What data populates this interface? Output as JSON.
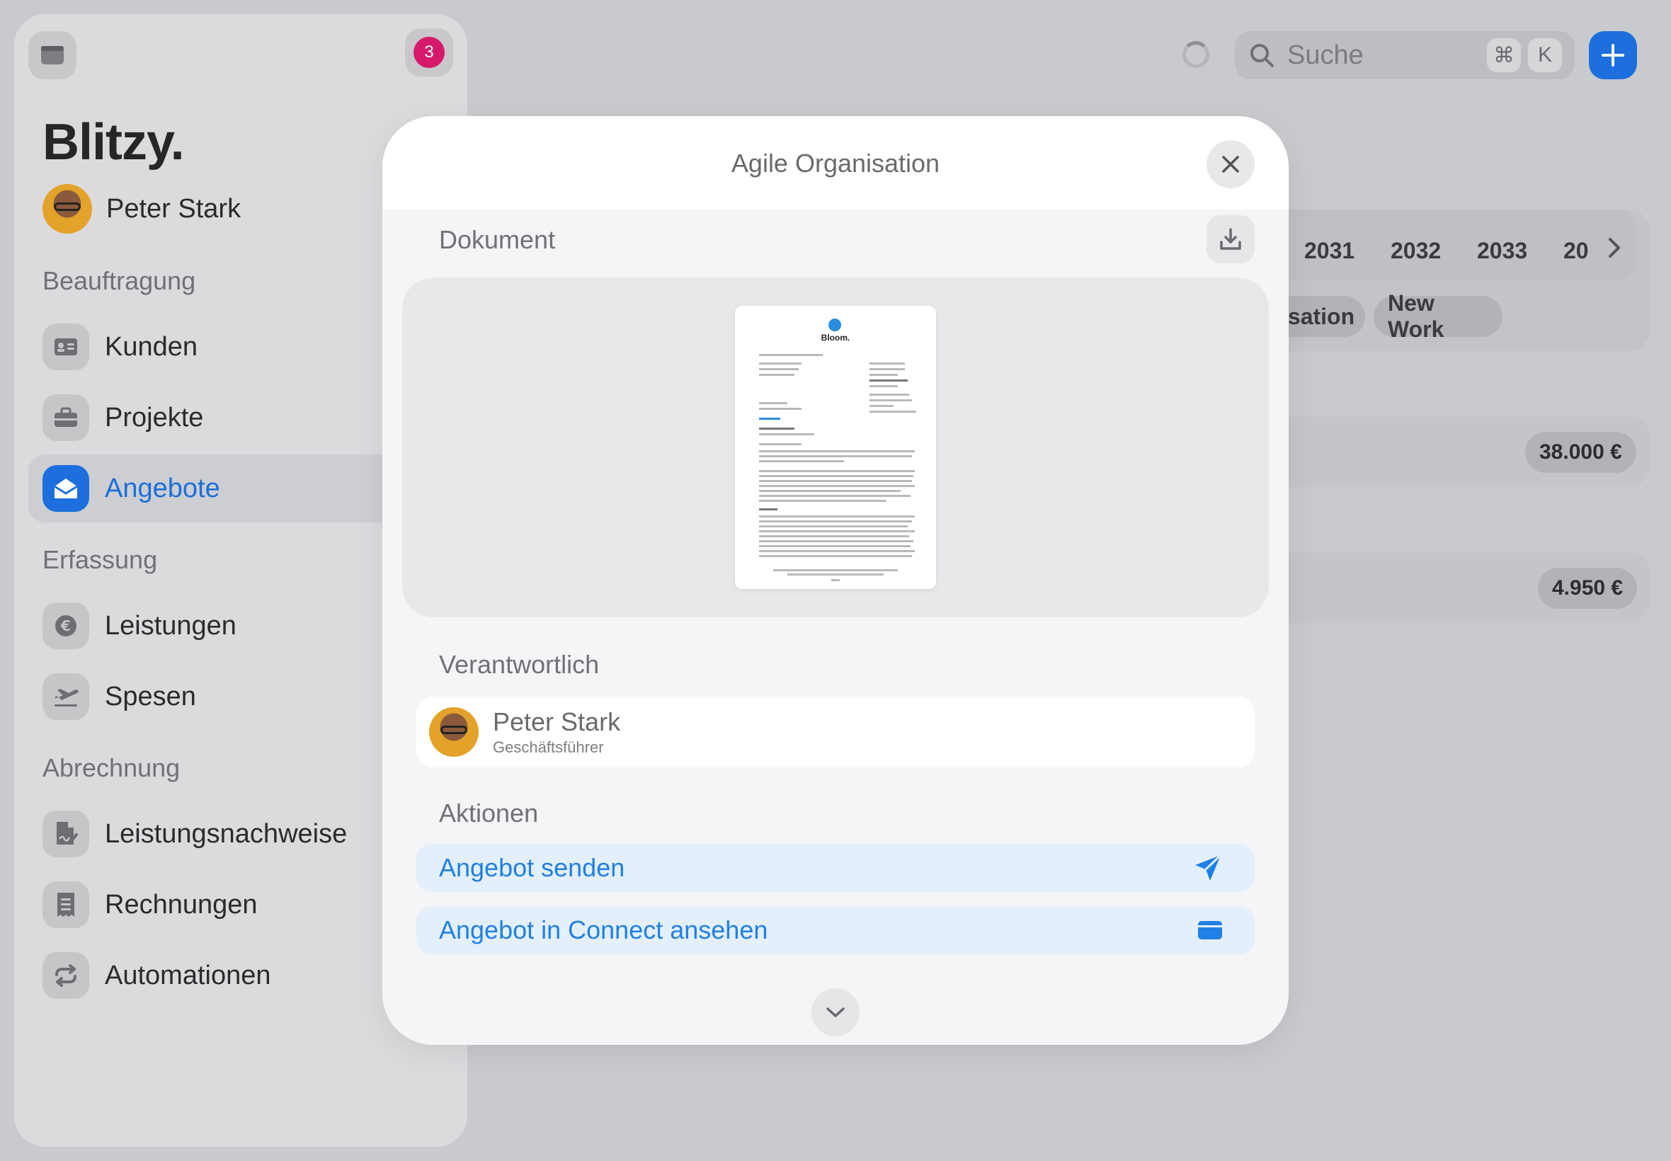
{
  "sidebar": {
    "notification_count": "3",
    "brand": "Blitzy.",
    "user_name": "Peter Stark",
    "sections": {
      "beauftragung": "Beauftragung",
      "erfassung": "Erfassung",
      "abrechnung": "Abrechnung"
    },
    "items": {
      "kunden": "Kunden",
      "projekte": "Projekte",
      "angebote": "Angebote",
      "leistungen": "Leistungen",
      "spesen": "Spesen",
      "leistungsnachweise": "Leistungsnachweise",
      "rechnungen": "Rechnungen",
      "automationen": "Automationen"
    },
    "accent_color": "#1c6fdc"
  },
  "topbar": {
    "search_label": "Suche",
    "shortcut_cmd": "⌘",
    "shortcut_key": "K"
  },
  "background": {
    "years": [
      "2031",
      "2032",
      "2033",
      "20"
    ],
    "tags": [
      "isation",
      "New Work"
    ],
    "amounts": [
      "38.000 €",
      "4.950 €"
    ]
  },
  "modal": {
    "title": "Agile Organisation",
    "document_section": "Dokument",
    "document_logo": "Bloom.",
    "responsible_section": "Verantwortlich",
    "responsible": {
      "name": "Peter Stark",
      "role": "Geschäftsführer"
    },
    "actions_section": "Aktionen",
    "actions": {
      "send": "Angebot senden",
      "view_connect": "Angebot in Connect ansehen"
    },
    "action_color": "#1f80e6"
  }
}
